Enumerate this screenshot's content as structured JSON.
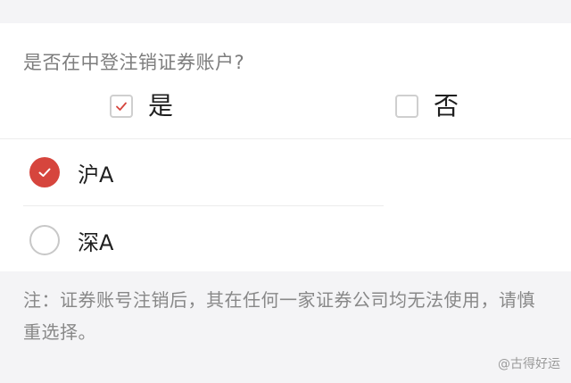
{
  "question": "是否在中登注销证券账户?",
  "options": [
    {
      "label": "是",
      "checked": true
    },
    {
      "label": "否",
      "checked": false
    }
  ],
  "accounts": [
    {
      "label": "沪A",
      "selected": true
    },
    {
      "label": "深A",
      "selected": false
    }
  ],
  "note": "注：证券账号注销后，其在任何一家证券公司均无法使用，请慎重选择。",
  "watermark": "@古得好运",
  "colors": {
    "accent": "#d6453d",
    "check_mark": "#d6453d",
    "text": "#1f1f1f",
    "muted": "#888888"
  }
}
